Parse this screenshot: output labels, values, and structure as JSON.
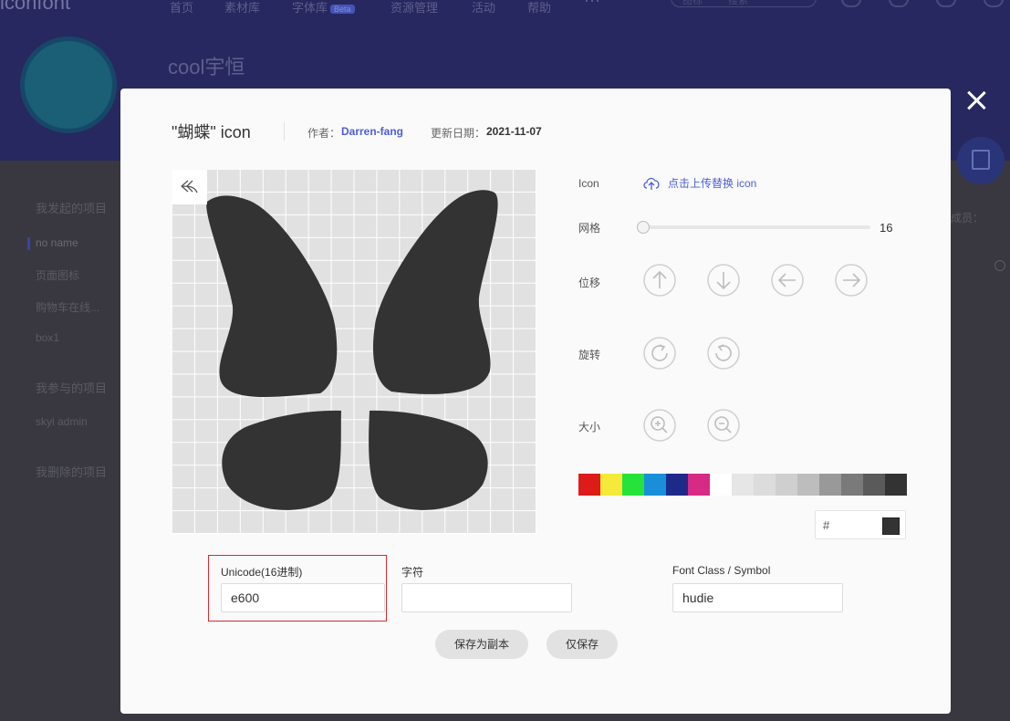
{
  "background": {
    "logo": "iconfont",
    "nav": [
      "首页",
      "素材库",
      "字体库",
      "资源管理",
      "活动",
      "帮助"
    ],
    "nav_badge": "Beta",
    "search_placeholder": "搜索",
    "search_scope": "图标",
    "project_title": "cool宇恒",
    "sidebar": {
      "my_projects": "我发起的项目",
      "my_items": [
        "no name",
        "页面图标",
        "购物车在线...",
        "box1"
      ],
      "joined_projects": "我参与的项目",
      "joined_items": [
        "skyi admin"
      ],
      "deleted_projects": "我删除的项目"
    },
    "member_label": "成员："
  },
  "modal": {
    "title": "\"蝴蝶\" icon",
    "author_label": "作者：",
    "author": "Darren-fang",
    "date_label": "更新日期：",
    "date": "2021-11-07",
    "controls": {
      "icon_label": "Icon",
      "upload_label": "点击上传替换 icon",
      "grid_label": "网格",
      "grid_value": "16",
      "grid_value_num": 16,
      "move_label": "位移",
      "rotate_label": "旋转",
      "size_label": "大小",
      "hex_prefix": "#",
      "current_color": "#333333"
    },
    "swatch_colors": [
      "#dd1c1a",
      "#f5e93a",
      "#26e23a",
      "#1a8fd9",
      "#1e2a8a",
      "#d62a85",
      "#ffffff",
      "#e6e6e6",
      "#dcdcdc",
      "#cfcfcf",
      "#bdbdbd",
      "#999999",
      "#7a7a7a",
      "#5a5a5a",
      "#333333"
    ],
    "fields": {
      "unicode_label": "Unicode(16进制)",
      "unicode_value": "e600",
      "char_label": "字符",
      "char_value": "",
      "fontclass_label": "Font Class / Symbol",
      "fontclass_value": "hudie"
    },
    "buttons": {
      "save_copy": "保存为副本",
      "save_only": "仅保存"
    }
  }
}
